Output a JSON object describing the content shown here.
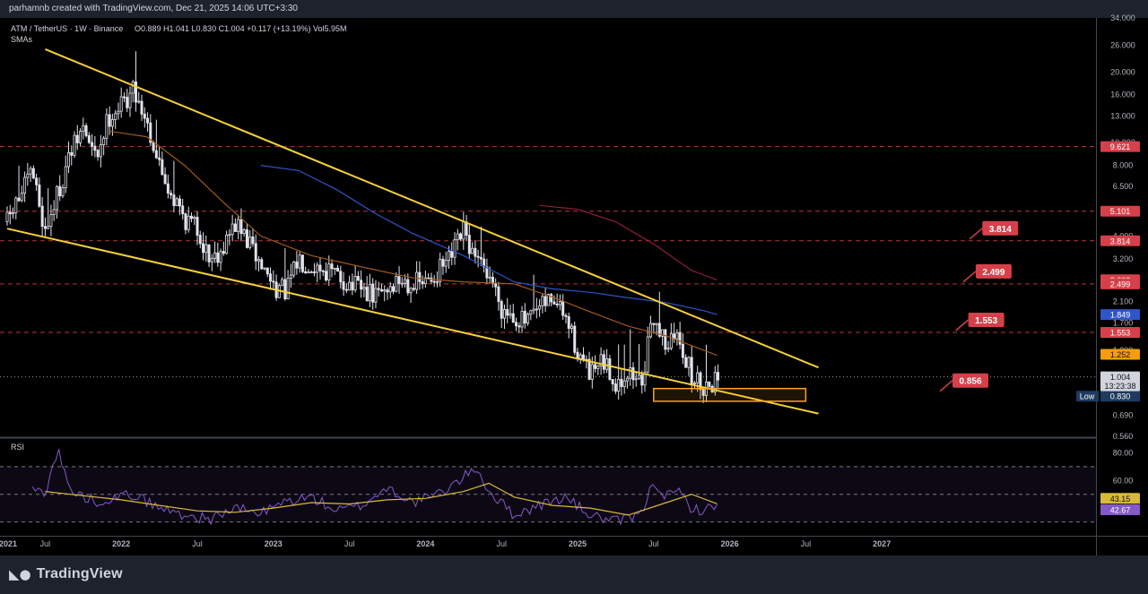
{
  "header": {
    "attribution": "parhamnb created with TradingView.com, Dec 21, 2025 14:06 UTC+3:30"
  },
  "legend": {
    "symbol": "ATM / TetherUS",
    "interval": "1W",
    "exchange": "Binance",
    "ohlc": "O0.889  H1.041  L0.830  C1.004  +0.117 (+13.19%)  Vol5.95M",
    "indicator": "SMAs"
  },
  "rsi_title": "RSI",
  "footer": {
    "brand": "TradingView"
  },
  "colors": {
    "background": "#000000",
    "candle": "#e0e3eb",
    "trendline": "#f5d03a",
    "sma_orange": "#a05a1c",
    "sma_blue": "#2f55c9",
    "sma_red": "#8e1f34",
    "resistance": "#d6404a",
    "rsi_line": "#8559c9",
    "rsi_ma": "#d9b93a"
  },
  "chart_data": [
    {
      "type": "candlestick",
      "title": "ATM / TetherUS · 1W · Binance",
      "scale": "log",
      "ylim": [
        0.56,
        34
      ],
      "xlim": [
        "2021-04",
        "2027-07"
      ],
      "x_ticks": [
        "2021",
        "Jul",
        "2022",
        "Jul",
        "2023",
        "Jul",
        "2024",
        "Jul",
        "2025",
        "Jul",
        "2026",
        "Jul",
        "2027"
      ],
      "y_ticks": [
        0.56,
        0.69,
        1.0,
        1.3,
        1.7,
        2.1,
        3.2,
        4.0,
        6.5,
        8.0,
        10.0,
        13.0,
        16.0,
        20.0,
        26.0,
        34.0
      ],
      "y_tick_labels": [
        "0.560",
        "0.690",
        "1.000",
        "1.300",
        "1.700",
        "2.100",
        "3.200",
        "4.000",
        "6.500",
        "8.000",
        "10.000",
        "13.000",
        "16.000",
        "20.000",
        "26.000",
        "34.000"
      ],
      "price_anchors": [
        [
          "2021-04",
          4.6
        ],
        [
          "2021-06",
          7.5
        ],
        [
          "2021-07",
          4.2
        ],
        [
          "2021-09",
          9.0
        ],
        [
          "2021-10",
          11.5
        ],
        [
          "2021-11",
          8.5
        ],
        [
          "2021-12",
          13.0
        ],
        [
          "2022-01",
          14.5
        ],
        [
          "2022-02",
          17.0
        ],
        [
          "2022-03",
          12.5
        ],
        [
          "2022-04",
          8.0
        ],
        [
          "2022-05",
          6.0
        ],
        [
          "2022-06",
          4.8
        ],
        [
          "2022-07",
          4.3
        ],
        [
          "2022-08",
          3.2
        ],
        [
          "2022-09",
          3.6
        ],
        [
          "2022-10",
          4.5
        ],
        [
          "2022-11",
          3.8
        ],
        [
          "2022-12",
          3.0
        ],
        [
          "2023-01",
          2.5
        ],
        [
          "2023-02",
          2.3
        ],
        [
          "2023-03",
          3.2
        ],
        [
          "2023-05",
          2.9
        ],
        [
          "2023-07",
          2.5
        ],
        [
          "2023-09",
          2.2
        ],
        [
          "2023-11",
          2.6
        ],
        [
          "2024-01",
          2.5
        ],
        [
          "2024-03",
          3.2
        ],
        [
          "2024-04",
          4.2
        ],
        [
          "2024-05",
          3.0
        ],
        [
          "2024-06",
          2.8
        ],
        [
          "2024-07",
          2.0
        ],
        [
          "2024-09",
          1.7
        ],
        [
          "2024-11",
          2.2
        ],
        [
          "2024-12",
          1.8
        ],
        [
          "2025-01",
          1.3
        ],
        [
          "2025-02",
          1.0
        ],
        [
          "2025-03",
          1.15
        ],
        [
          "2025-04",
          0.95
        ],
        [
          "2025-05",
          1.05
        ],
        [
          "2025-06",
          0.95
        ],
        [
          "2025-07",
          1.8
        ],
        [
          "2025-08",
          1.4
        ],
        [
          "2025-09",
          1.5
        ],
        [
          "2025-10",
          1.0
        ],
        [
          "2025-11",
          0.92
        ],
        [
          "2025-12",
          1.004
        ]
      ],
      "trendlines": [
        {
          "name": "upper",
          "from": [
            "2021-07",
            25.0
          ],
          "to": [
            "2026-08",
            1.1
          ]
        },
        {
          "name": "lower",
          "from": [
            "2021-04",
            4.3
          ],
          "to": [
            "2026-08",
            0.7
          ]
        }
      ],
      "sma_lines": [
        {
          "color": "#a05a1c",
          "points": [
            [
              "2021-12",
              11.2
            ],
            [
              "2022-03",
              10.6
            ],
            [
              "2022-06",
              8.0
            ],
            [
              "2022-09",
              5.6
            ],
            [
              "2022-12",
              4.0
            ],
            [
              "2023-04",
              3.3
            ],
            [
              "2023-08",
              2.95
            ],
            [
              "2023-12",
              2.65
            ],
            [
              "2024-04",
              2.55
            ],
            [
              "2024-08",
              2.5
            ],
            [
              "2024-11",
              2.2
            ],
            [
              "2025-02",
              1.9
            ],
            [
              "2025-05",
              1.65
            ],
            [
              "2025-08",
              1.5
            ],
            [
              "2025-11",
              1.3
            ],
            [
              "2025-12",
              1.24
            ]
          ]
        },
        {
          "color": "#2f55c9",
          "points": [
            [
              "2022-12",
              8.0
            ],
            [
              "2023-03",
              7.6
            ],
            [
              "2023-06",
              6.3
            ],
            [
              "2023-09",
              5.0
            ],
            [
              "2023-12",
              4.1
            ],
            [
              "2024-04",
              3.3
            ],
            [
              "2024-08",
              2.55
            ],
            [
              "2024-11",
              2.38
            ],
            [
              "2025-02",
              2.3
            ],
            [
              "2025-05",
              2.18
            ],
            [
              "2025-08",
              2.08
            ],
            [
              "2025-11",
              1.92
            ],
            [
              "2025-12",
              1.85
            ]
          ]
        },
        {
          "color": "#8e1f34",
          "points": [
            [
              "2024-10",
              5.4
            ],
            [
              "2025-01",
              5.2
            ],
            [
              "2025-04",
              4.6
            ],
            [
              "2025-07",
              3.7
            ],
            [
              "2025-10",
              2.85
            ],
            [
              "2025-12",
              2.6
            ]
          ]
        }
      ],
      "resistance_levels": [
        9.621,
        5.101,
        3.814,
        2.499,
        1.553
      ],
      "price_labels": [
        {
          "text": "9.621",
          "value": 9.621,
          "kind": "level"
        },
        {
          "text": "5.101",
          "value": 5.101,
          "kind": "level"
        },
        {
          "text": "3.814",
          "value": 3.814,
          "kind": "level"
        },
        {
          "text": "2.603",
          "value": 2.603,
          "kind": "sma-red"
        },
        {
          "text": "2.499",
          "value": 2.499,
          "kind": "level"
        },
        {
          "text": "1.849",
          "value": 1.849,
          "kind": "sma-blue"
        },
        {
          "text": "1.553",
          "value": 1.553,
          "kind": "level"
        },
        {
          "text": "1.252",
          "value": 1.252,
          "kind": "sma-orange"
        },
        {
          "text": "0.830",
          "value": 0.83,
          "kind": "low"
        }
      ],
      "current_price": {
        "text": "1.004",
        "countdown": "13:23:38",
        "value": 1.004
      },
      "low_label": "Low",
      "target_callouts": [
        {
          "text": "3.814",
          "value": 3.814
        },
        {
          "text": "2.499",
          "value": 2.499
        },
        {
          "text": "1.553",
          "value": 1.553
        },
        {
          "text": "0.856",
          "value": 0.856
        }
      ],
      "support_zone": {
        "from": "2025-07",
        "to": "2026-07",
        "low": 0.79,
        "high": 0.895
      }
    },
    {
      "type": "line",
      "title": "RSI",
      "ylim": [
        20,
        90
      ],
      "y_ticks": [
        80.0,
        60.0
      ],
      "y_tick_labels": [
        "80.00",
        "60.00"
      ],
      "bands": [
        70,
        50,
        30
      ],
      "rsi_anchors": [
        [
          "2021-06",
          53
        ],
        [
          "2021-07",
          52
        ],
        [
          "2021-08",
          82
        ],
        [
          "2021-09",
          52
        ],
        [
          "2021-11",
          45
        ],
        [
          "2022-02",
          50
        ],
        [
          "2022-04",
          40
        ],
        [
          "2022-06",
          35
        ],
        [
          "2022-08",
          32
        ],
        [
          "2022-10",
          40
        ],
        [
          "2022-12",
          36
        ],
        [
          "2023-02",
          45
        ],
        [
          "2023-04",
          48
        ],
        [
          "2023-06",
          38
        ],
        [
          "2023-08",
          42
        ],
        [
          "2023-10",
          55
        ],
        [
          "2023-12",
          44
        ],
        [
          "2024-02",
          50
        ],
        [
          "2024-04",
          62
        ],
        [
          "2024-05",
          70
        ],
        [
          "2024-06",
          52
        ],
        [
          "2024-08",
          35
        ],
        [
          "2024-10",
          42
        ],
        [
          "2024-12",
          48
        ],
        [
          "2025-02",
          35
        ],
        [
          "2025-04",
          30
        ],
        [
          "2025-06",
          35
        ],
        [
          "2025-07",
          60
        ],
        [
          "2025-08",
          48
        ],
        [
          "2025-09",
          52
        ],
        [
          "2025-10",
          40
        ],
        [
          "2025-11",
          38
        ],
        [
          "2025-12",
          42.67
        ]
      ],
      "rsi_ma_anchors": [
        [
          "2021-07",
          52
        ],
        [
          "2021-10",
          49
        ],
        [
          "2022-01",
          46
        ],
        [
          "2022-04",
          42
        ],
        [
          "2022-07",
          38
        ],
        [
          "2022-10",
          37
        ],
        [
          "2023-01",
          40
        ],
        [
          "2023-04",
          44
        ],
        [
          "2023-07",
          43
        ],
        [
          "2023-10",
          46
        ],
        [
          "2024-01",
          47
        ],
        [
          "2024-04",
          52
        ],
        [
          "2024-06",
          58
        ],
        [
          "2024-08",
          48
        ],
        [
          "2024-11",
          42
        ],
        [
          "2025-02",
          40
        ],
        [
          "2025-05",
          35
        ],
        [
          "2025-08",
          44
        ],
        [
          "2025-10",
          50
        ],
        [
          "2025-12",
          43.15
        ]
      ],
      "value_labels": [
        {
          "text": "43.15",
          "value": 43.15,
          "kind": "ma"
        },
        {
          "text": "42.67",
          "value": 42.67,
          "kind": "rsi"
        }
      ]
    }
  ]
}
